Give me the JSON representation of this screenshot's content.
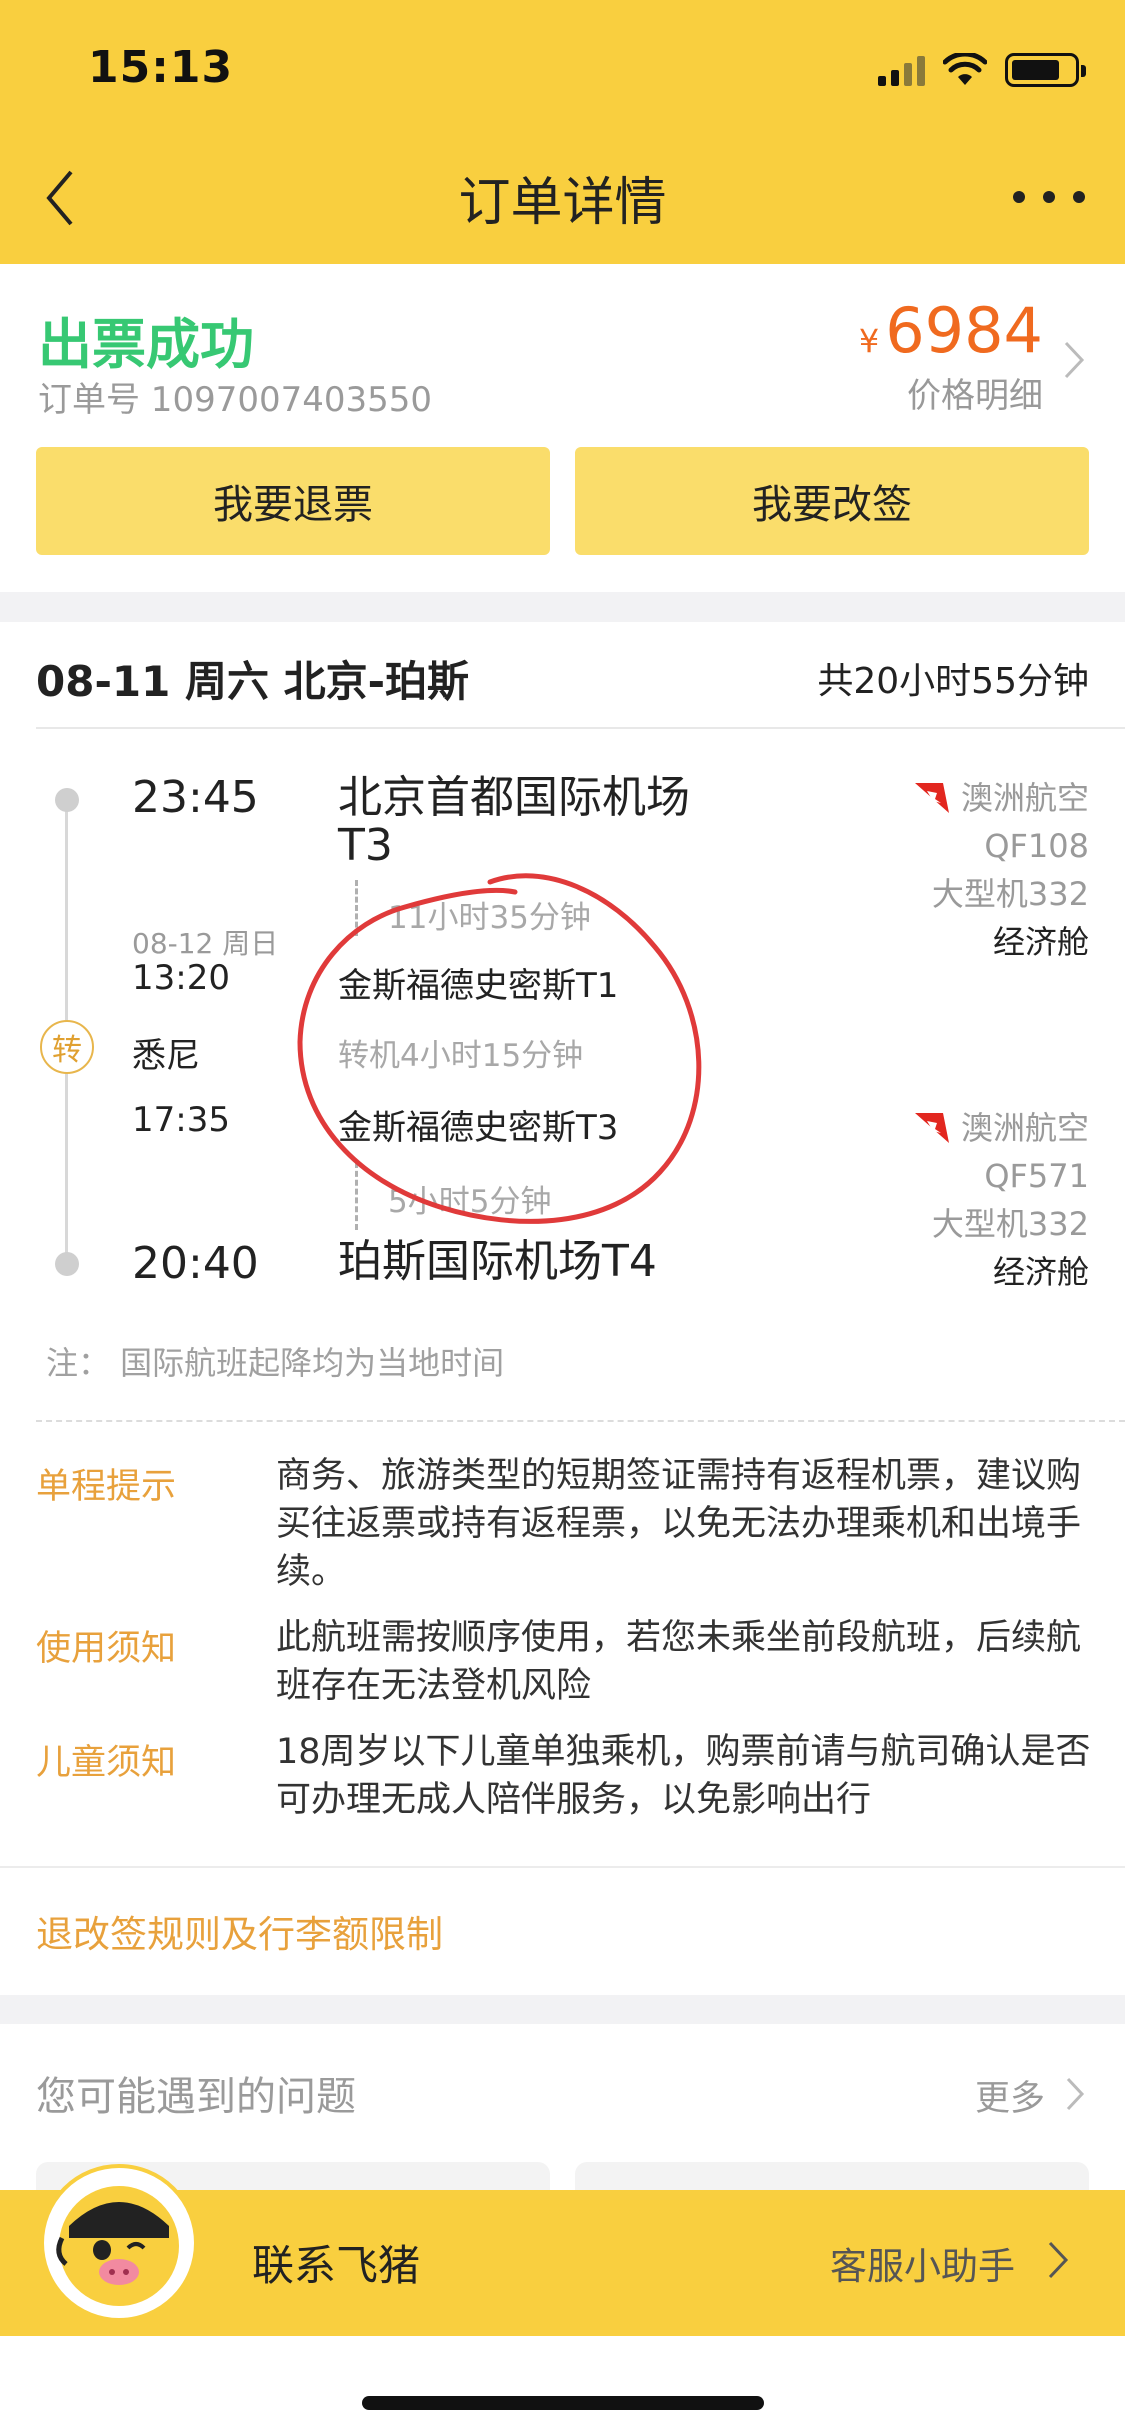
{
  "status_bar": {
    "time": "15:13"
  },
  "nav": {
    "title": "订单详情",
    "back_icon": "chevron-left-icon",
    "more_icon": "more-dots-icon"
  },
  "order": {
    "status": "出票成功",
    "order_number": "订单号 1097007403550",
    "currency_symbol": "¥",
    "price": "6984",
    "price_detail": "价格明细",
    "refund_label": "我要退票",
    "change_label": "我要改签"
  },
  "flight": {
    "route_title": "08-11 周六 北京-珀斯",
    "total_duration": "共20小时55分钟",
    "depart_time": "23:45",
    "depart_airport": "北京首都国际机场T3",
    "leg1_duration": "11小时35分钟",
    "transfer_arrive_date": "08-12 周日",
    "transfer_arrive_time": "13:20",
    "transfer_arrive_airport": "金斯福德史密斯T1",
    "transfer_badge": "转",
    "transfer_city": "悉尼",
    "transfer_wait": "转机4小时15分钟",
    "transfer_depart_time": "17:35",
    "transfer_depart_airport": "金斯福德史密斯T3",
    "leg2_duration": "5小时5分钟",
    "arrive_time": "20:40",
    "arrive_airport": "珀斯国际机场T4",
    "leg1": {
      "airline": "澳洲航空",
      "flight_no": "QF108",
      "aircraft": "大型机332",
      "cabin": "经济舱"
    },
    "leg2": {
      "airline": "澳洲航空",
      "flight_no": "QF571",
      "aircraft": "大型机332",
      "cabin": "经济舱"
    },
    "note": "注：  国际航班起降均为当地时间"
  },
  "tips": [
    {
      "label": "单程提示",
      "text": "商务、旅游类型的短期签证需持有返程机票，建议购买往返票或持有返程票，以免无法办理乘机和出境手续。"
    },
    {
      "label": "使用须知",
      "text": "此航班需按顺序使用，若您未乘坐前段航班，后续航班存在无法登机风险"
    },
    {
      "label": "儿童须知",
      "text": "18周岁以下儿童单独乘机，购票前请与航司确认是否可办理无成人陪伴服务，以免影响出行"
    }
  ],
  "rules_link": "退改签规则及行李额限制",
  "questions": {
    "title": "您可能遇到的问题",
    "more": "更多"
  },
  "contact": {
    "label": "联系飞猪",
    "helper": "客服小助手"
  },
  "colors": {
    "header": "#f9cf3f",
    "success": "#37c873",
    "price": "#f06a1f",
    "accent": "#e8a13c",
    "annotation": "#e03a3a"
  }
}
